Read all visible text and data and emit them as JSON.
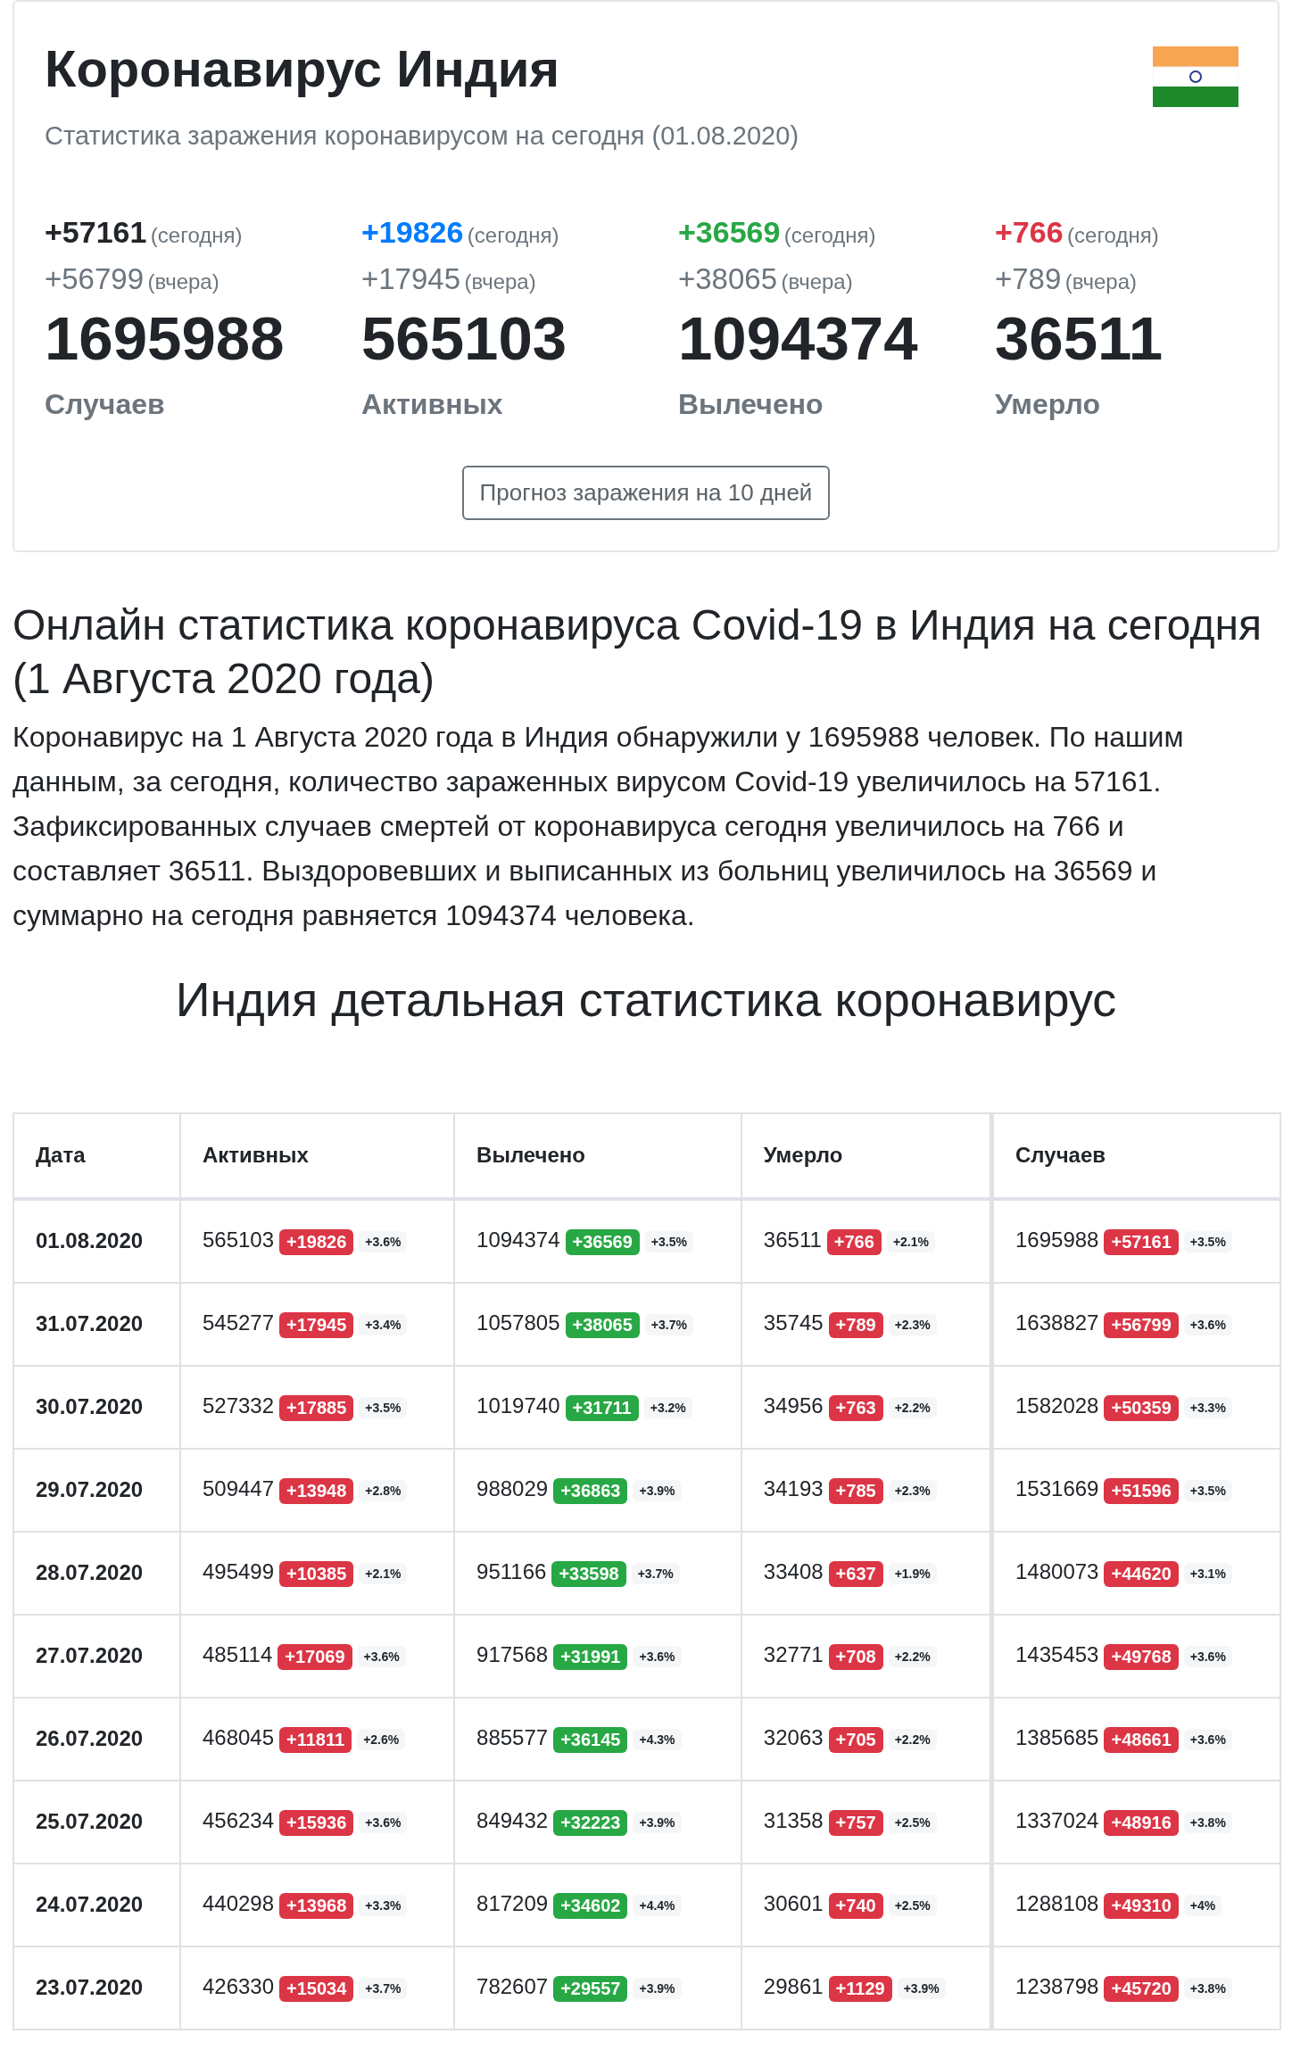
{
  "header": {
    "title": "Коронавирус Индия",
    "subtitle": "Статистика заражения коронавирусом на сегодня (01.08.2020)"
  },
  "stats": [
    {
      "today": "+57161",
      "today_label": "(сегодня)",
      "yesterday": "+56799",
      "yesterday_label": "(вчера)",
      "total": "1695988",
      "label": "Случаев",
      "color": "#212529"
    },
    {
      "today": "+19826",
      "today_label": "(сегодня)",
      "yesterday": "+17945",
      "yesterday_label": "(вчера)",
      "total": "565103",
      "label": "Активных",
      "color": "#007bff"
    },
    {
      "today": "+36569",
      "today_label": "(сегодня)",
      "yesterday": "+38065",
      "yesterday_label": "(вчера)",
      "total": "1094374",
      "label": "Вылечено",
      "color": "#28a745"
    },
    {
      "today": "+766",
      "today_label": "(сегодня)",
      "yesterday": "+789",
      "yesterday_label": "(вчера)",
      "total": "36511",
      "label": "Умерло",
      "color": "#dc3545"
    }
  ],
  "forecast_button": "Прогноз заражения на 10 дней",
  "article": {
    "heading": "Онлайн статистика коронавируса Covid-19 в Индия на сегодня (1 Августа 2020 года)",
    "text": "Коронавирус на 1 Августа 2020 года в Индия обнаружили у 1695988 человек. По нашим данным, за сегодня, количество зараженных вирусом Covid-19 увеличилось на 57161. Зафиксированных случаев смертей от коронавируса сегодня увеличилось на 766 и составляет 36511. Выздоровевших и выписанных из больниц увеличилось на 36569 и суммарно на сегодня равняется 1094374 человека."
  },
  "table_title": "Индия детальная статистика коронавирус",
  "table": {
    "columns": [
      {
        "label": "Дата"
      },
      {
        "label": "Активных",
        "color": "#dc3545"
      },
      {
        "label": "Вылечено",
        "color": "#28a745"
      },
      {
        "label": "Умерло",
        "color": "#dc3545"
      },
      {
        "label": "Случаев",
        "color": "#dc3545"
      }
    ],
    "rows": [
      {
        "cells": [
          {
            "kind": "date",
            "value": "01.08.2020"
          },
          {
            "kind": "count",
            "value": "565103",
            "delta": "+19826",
            "percent": "+3.6%"
          },
          {
            "kind": "count",
            "value": "1094374",
            "delta": "+36569",
            "percent": "+3.5%"
          },
          {
            "kind": "count",
            "value": "36511",
            "delta": "+766",
            "percent": "+2.1%"
          },
          {
            "kind": "count",
            "value": "1695988",
            "delta": "+57161",
            "percent": "+3.5%"
          }
        ]
      },
      {
        "cells": [
          {
            "kind": "date",
            "value": "31.07.2020"
          },
          {
            "kind": "count",
            "value": "545277",
            "delta": "+17945",
            "percent": "+3.4%"
          },
          {
            "kind": "count",
            "value": "1057805",
            "delta": "+38065",
            "percent": "+3.7%"
          },
          {
            "kind": "count",
            "value": "35745",
            "delta": "+789",
            "percent": "+2.3%"
          },
          {
            "kind": "count",
            "value": "1638827",
            "delta": "+56799",
            "percent": "+3.6%"
          }
        ]
      },
      {
        "cells": [
          {
            "kind": "date",
            "value": "30.07.2020"
          },
          {
            "kind": "count",
            "value": "527332",
            "delta": "+17885",
            "percent": "+3.5%"
          },
          {
            "kind": "count",
            "value": "1019740",
            "delta": "+31711",
            "percent": "+3.2%"
          },
          {
            "kind": "count",
            "value": "34956",
            "delta": "+763",
            "percent": "+2.2%"
          },
          {
            "kind": "count",
            "value": "1582028",
            "delta": "+50359",
            "percent": "+3.3%"
          }
        ]
      },
      {
        "cells": [
          {
            "kind": "date",
            "value": "29.07.2020"
          },
          {
            "kind": "count",
            "value": "509447",
            "delta": "+13948",
            "percent": "+2.8%"
          },
          {
            "kind": "count",
            "value": "988029",
            "delta": "+36863",
            "percent": "+3.9%"
          },
          {
            "kind": "count",
            "value": "34193",
            "delta": "+785",
            "percent": "+2.3%"
          },
          {
            "kind": "count",
            "value": "1531669",
            "delta": "+51596",
            "percent": "+3.5%"
          }
        ]
      },
      {
        "cells": [
          {
            "kind": "date",
            "value": "28.07.2020"
          },
          {
            "kind": "count",
            "value": "495499",
            "delta": "+10385",
            "percent": "+2.1%"
          },
          {
            "kind": "count",
            "value": "951166",
            "delta": "+33598",
            "percent": "+3.7%"
          },
          {
            "kind": "count",
            "value": "33408",
            "delta": "+637",
            "percent": "+1.9%"
          },
          {
            "kind": "count",
            "value": "1480073",
            "delta": "+44620",
            "percent": "+3.1%"
          }
        ]
      },
      {
        "cells": [
          {
            "kind": "date",
            "value": "27.07.2020"
          },
          {
            "kind": "count",
            "value": "485114",
            "delta": "+17069",
            "percent": "+3.6%"
          },
          {
            "kind": "count",
            "value": "917568",
            "delta": "+31991",
            "percent": "+3.6%"
          },
          {
            "kind": "count",
            "value": "32771",
            "delta": "+708",
            "percent": "+2.2%"
          },
          {
            "kind": "count",
            "value": "1435453",
            "delta": "+49768",
            "percent": "+3.6%"
          }
        ]
      },
      {
        "cells": [
          {
            "kind": "date",
            "value": "26.07.2020"
          },
          {
            "kind": "count",
            "value": "468045",
            "delta": "+11811",
            "percent": "+2.6%"
          },
          {
            "kind": "count",
            "value": "885577",
            "delta": "+36145",
            "percent": "+4.3%"
          },
          {
            "kind": "count",
            "value": "32063",
            "delta": "+705",
            "percent": "+2.2%"
          },
          {
            "kind": "count",
            "value": "1385685",
            "delta": "+48661",
            "percent": "+3.6%"
          }
        ]
      },
      {
        "cells": [
          {
            "kind": "date",
            "value": "25.07.2020"
          },
          {
            "kind": "count",
            "value": "456234",
            "delta": "+15936",
            "percent": "+3.6%"
          },
          {
            "kind": "count",
            "value": "849432",
            "delta": "+32223",
            "percent": "+3.9%"
          },
          {
            "kind": "count",
            "value": "31358",
            "delta": "+757",
            "percent": "+2.5%"
          },
          {
            "kind": "count",
            "value": "1337024",
            "delta": "+48916",
            "percent": "+3.8%"
          }
        ]
      },
      {
        "cells": [
          {
            "kind": "date",
            "value": "24.07.2020"
          },
          {
            "kind": "count",
            "value": "440298",
            "delta": "+13968",
            "percent": "+3.3%"
          },
          {
            "kind": "count",
            "value": "817209",
            "delta": "+34602",
            "percent": "+4.4%"
          },
          {
            "kind": "count",
            "value": "30601",
            "delta": "+740",
            "percent": "+2.5%"
          },
          {
            "kind": "count",
            "value": "1288108",
            "delta": "+49310",
            "percent": "+4%"
          }
        ]
      },
      {
        "cells": [
          {
            "kind": "date",
            "value": "23.07.2020"
          },
          {
            "kind": "count",
            "value": "426330",
            "delta": "+15034",
            "percent": "+3.7%"
          },
          {
            "kind": "count",
            "value": "782607",
            "delta": "+29557",
            "percent": "+3.9%"
          },
          {
            "kind": "count",
            "value": "29861",
            "delta": "+1129",
            "percent": "+3.9%"
          },
          {
            "kind": "count",
            "value": "1238798",
            "delta": "+45720",
            "percent": "+3.8%"
          }
        ]
      }
    ]
  }
}
